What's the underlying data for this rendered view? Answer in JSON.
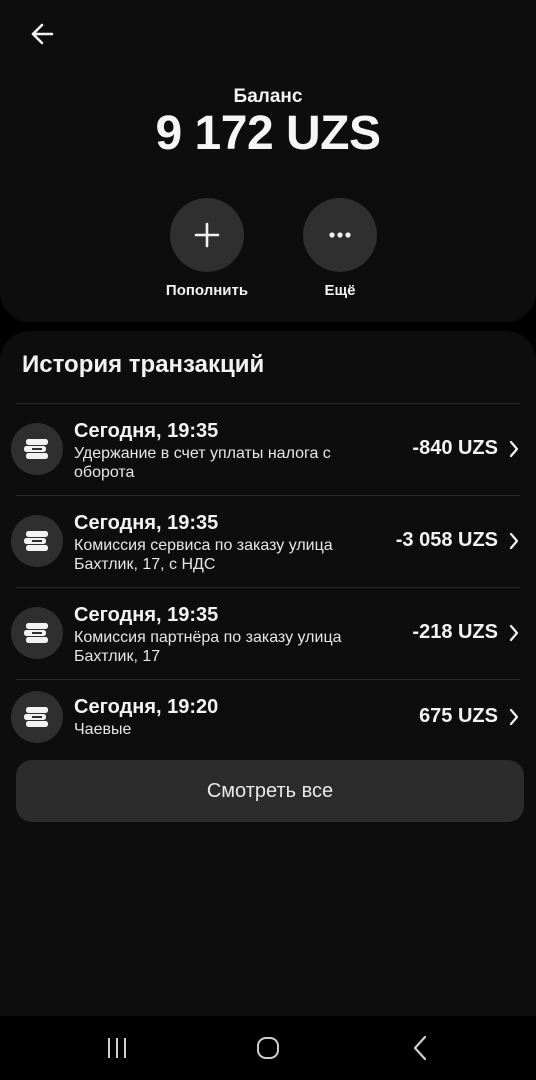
{
  "header": {
    "back_icon": "arrow-left-icon"
  },
  "balance": {
    "label": "Баланс",
    "amount": "9 172 UZS"
  },
  "actions": [
    {
      "label": "Пополнить",
      "icon": "plus-icon"
    },
    {
      "label": "Ещё",
      "icon": "more-dots-icon"
    }
  ],
  "history": {
    "title": "История транзакций",
    "transactions": [
      {
        "date": "Сегодня, 19:35",
        "description": "Удержание в счет уплаты налога с оборота",
        "amount": "-840 UZS",
        "icon": "cash-stack-icon"
      },
      {
        "date": "Сегодня, 19:35",
        "description": "Комиссия сервиса по заказу улица Бахтлик, 17, с НДС",
        "amount": "-3 058 UZS",
        "icon": "cash-stack-icon"
      },
      {
        "date": "Сегодня, 19:35",
        "description": "Комиссия партнёра по заказу улица Бахтлик, 17",
        "amount": "-218 UZS",
        "icon": "cash-stack-icon"
      },
      {
        "date": "Сегодня, 19:20",
        "description": "Чаевые",
        "amount": "675 UZS",
        "icon": "cash-stack-icon"
      }
    ],
    "view_all_label": "Смотреть все"
  },
  "navbar": {
    "recent_icon": "recent-apps-icon",
    "home_icon": "home-icon",
    "back_icon": "back-chevron-icon"
  },
  "colors": {
    "background": "#000000",
    "card": "#0d0d0d",
    "button": "#2f2f2f",
    "text": "#f2f2f2"
  }
}
